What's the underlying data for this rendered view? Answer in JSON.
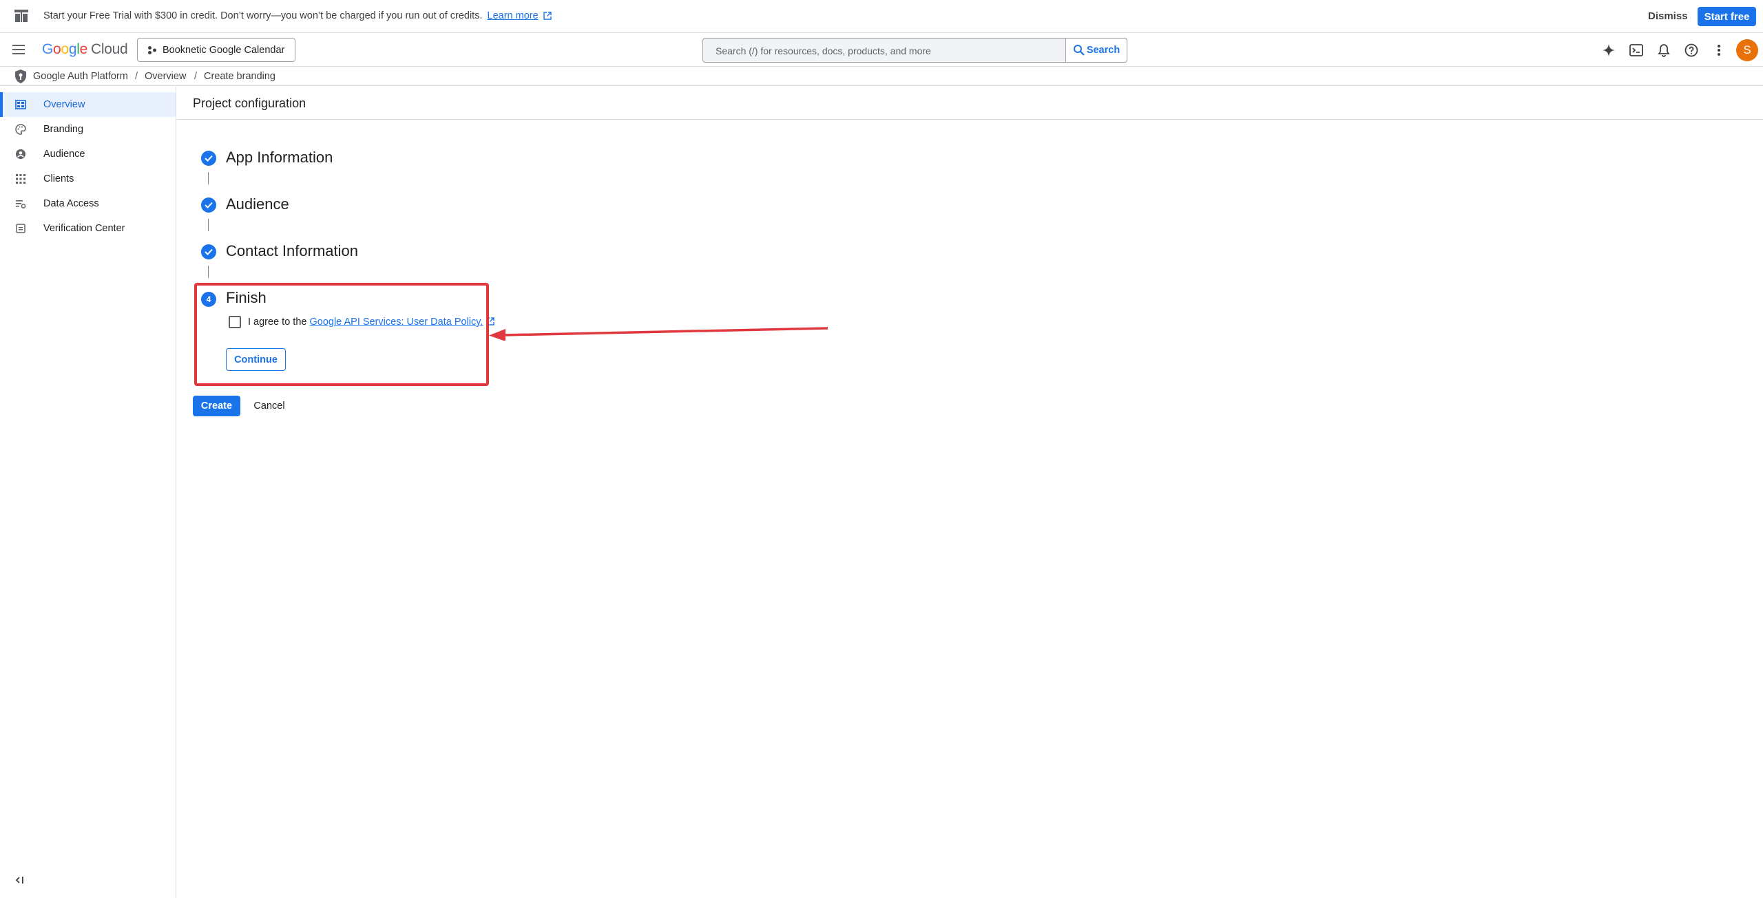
{
  "promo": {
    "message": "Start your Free Trial with $300 in credit. Don’t worry—you won’t be charged if you run out of credits.",
    "learn_more": "Learn more",
    "dismiss": "Dismiss",
    "start_free": "Start free"
  },
  "header": {
    "logo_google": [
      "G",
      "o",
      "o",
      "g",
      "l",
      "e"
    ],
    "logo_product": "Cloud",
    "project_name": "Booknetic Google Calendar",
    "search_placeholder": "Search (/) for resources, docs, products, and more",
    "search_button": "Search",
    "avatar_initial": "S"
  },
  "breadcrumb": {
    "items": [
      "Google Auth Platform",
      "Overview",
      "Create branding"
    ],
    "separator": "/"
  },
  "sidebar": {
    "items": [
      {
        "label": "Overview",
        "icon": "dashboard-icon",
        "active": true
      },
      {
        "label": "Branding",
        "icon": "palette-icon",
        "active": false
      },
      {
        "label": "Audience",
        "icon": "account-circle-icon",
        "active": false
      },
      {
        "label": "Clients",
        "icon": "apps-grid-icon",
        "active": false
      },
      {
        "label": "Data Access",
        "icon": "data-settings-icon",
        "active": false
      },
      {
        "label": "Verification Center",
        "icon": "verification-icon",
        "active": false
      }
    ]
  },
  "main": {
    "page_title": "Project configuration",
    "steps": [
      {
        "title": "App Information",
        "state": "complete"
      },
      {
        "title": "Audience",
        "state": "complete"
      },
      {
        "title": "Contact Information",
        "state": "complete"
      },
      {
        "title": "Finish",
        "state": "current",
        "number": "4"
      }
    ],
    "agree_prefix": "I agree to the",
    "agree_link": "Google API Services: User Data Policy.",
    "agree_checked": false,
    "continue_label": "Continue",
    "create_label": "Create",
    "cancel_label": "Cancel"
  },
  "colors": {
    "accent": "#1a73e8",
    "annotation": "#e0383e",
    "avatar": "#e8710a"
  }
}
